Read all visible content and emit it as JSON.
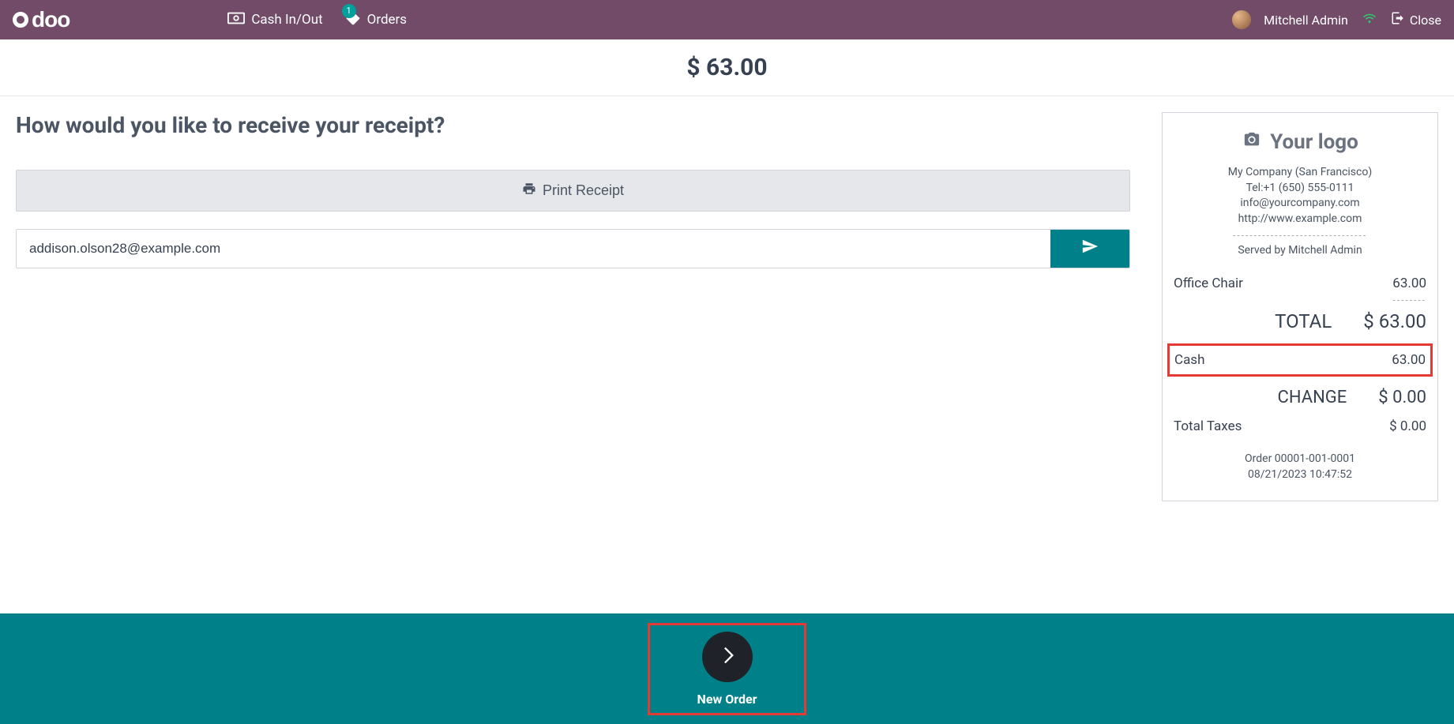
{
  "header": {
    "brand": "odoo",
    "nav": {
      "cash": "Cash In/Out",
      "orders": "Orders",
      "orders_badge": "1"
    },
    "user": "Mitchell Admin",
    "close": "Close"
  },
  "amount": "$ 63.00",
  "main": {
    "question": "How would you like to receive your receipt?",
    "print_label": "Print Receipt",
    "email_value": "addison.olson28@example.com"
  },
  "receipt": {
    "logo_text": "Your logo",
    "company": "My Company (San Francisco)",
    "tel": "Tel:+1 (650) 555-0111",
    "email": "info@yourcompany.com",
    "web": "http://www.example.com",
    "served": "Served by Mitchell Admin",
    "items": [
      {
        "name": "Office Chair",
        "price": "63.00"
      }
    ],
    "total_label": "TOTAL",
    "total_value": "$ 63.00",
    "cash_label": "Cash",
    "cash_value": "63.00",
    "change_label": "CHANGE",
    "change_value": "$ 0.00",
    "taxes_label": "Total Taxes",
    "taxes_value": "$ 0.00",
    "order_no": "Order 00001-001-0001",
    "order_dt": "08/21/2023 10:47:52"
  },
  "footer": {
    "new_order": "New Order"
  }
}
